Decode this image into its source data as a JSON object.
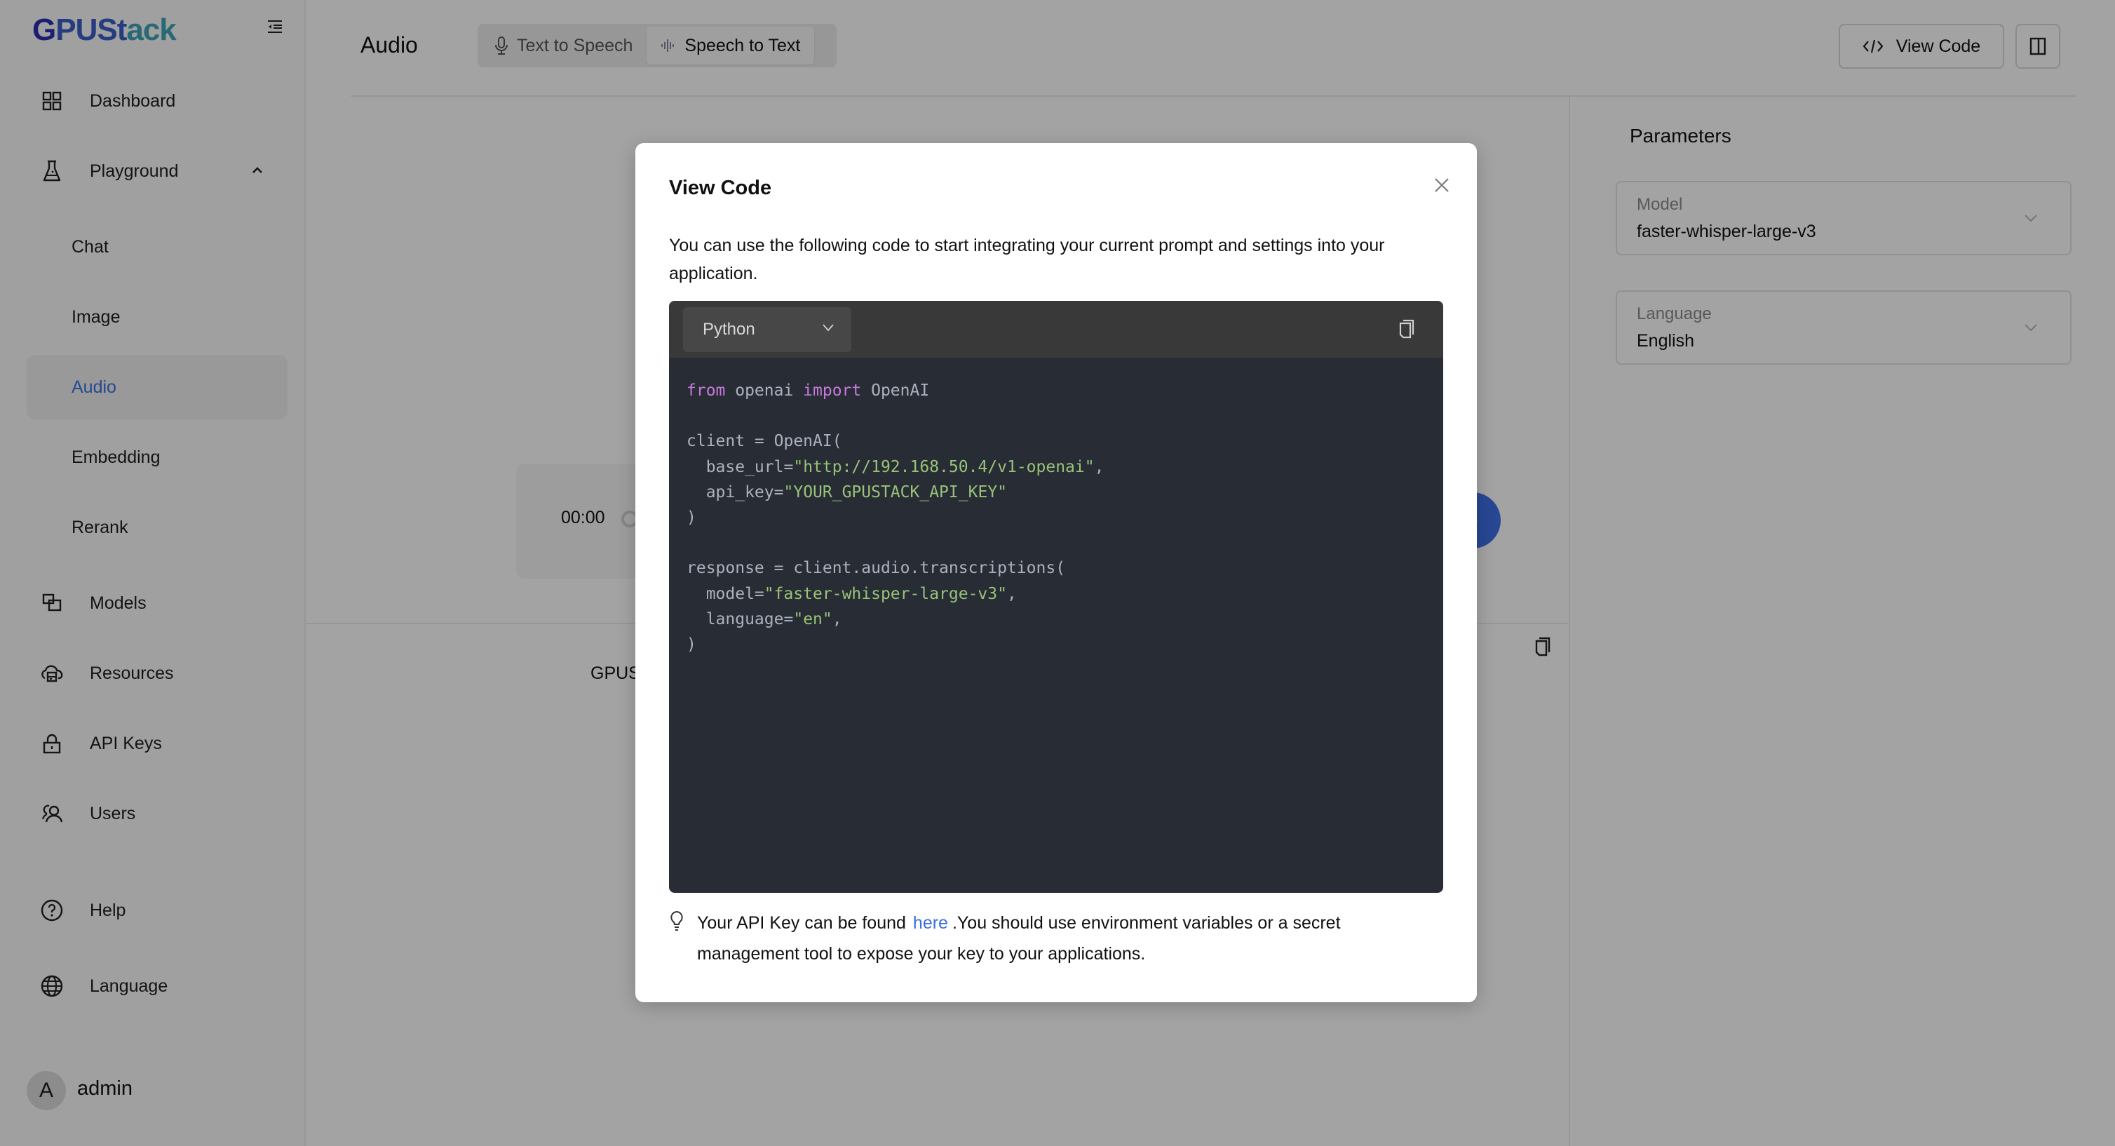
{
  "app": {
    "logo_text": [
      "G",
      "PUSt",
      "ack"
    ]
  },
  "sidebar": {
    "items": [
      {
        "id": "dashboard",
        "label": "Dashboard",
        "icon": "dashboard-grid-icon"
      },
      {
        "id": "playground",
        "label": "Playground",
        "icon": "flask-icon",
        "expanded": true
      },
      {
        "id": "chat",
        "label": "Chat",
        "sub": true
      },
      {
        "id": "image",
        "label": "Image",
        "sub": true
      },
      {
        "id": "audio",
        "label": "Audio",
        "sub": true,
        "active": true
      },
      {
        "id": "embedding",
        "label": "Embedding",
        "sub": true
      },
      {
        "id": "rerank",
        "label": "Rerank",
        "sub": true
      },
      {
        "id": "models",
        "label": "Models",
        "icon": "models-icon"
      },
      {
        "id": "resources",
        "label": "Resources",
        "icon": "resources-icon"
      },
      {
        "id": "api-keys",
        "label": "API Keys",
        "icon": "lock-icon"
      },
      {
        "id": "users",
        "label": "Users",
        "icon": "users-icon"
      },
      {
        "id": "help",
        "label": "Help",
        "icon": "help-icon"
      },
      {
        "id": "language",
        "label": "Language",
        "icon": "globe-icon"
      }
    ],
    "user": {
      "initial": "A",
      "name": "admin"
    }
  },
  "header": {
    "title": "Audio",
    "tabs": [
      {
        "label": "Text to Speech",
        "icon": "microphone-icon",
        "active": false
      },
      {
        "label": "Speech to Text",
        "icon": "waveform-icon",
        "active": true
      }
    ],
    "view_code_label": "View Code"
  },
  "main": {
    "timer": "00:00",
    "output_text_partial": "GPUS"
  },
  "parameters": {
    "title": "Parameters",
    "fields": [
      {
        "label": "Model",
        "value": "faster-whisper-large-v3"
      },
      {
        "label": "Language",
        "value": "English"
      }
    ]
  },
  "modal": {
    "title": "View Code",
    "description": "You can use the following code to start integrating your current prompt and settings into your application.",
    "language_selected": "Python",
    "code": {
      "base_url": "http://192.168.50.4/v1-openai",
      "api_key": "YOUR_GPUSTACK_API_KEY",
      "model": "faster-whisper-large-v3",
      "language": "en"
    },
    "tip_before": "Your API Key can be found",
    "tip_link": "here",
    "tip_after": ".You should use environment variables or a secret management tool to expose your key to your applications."
  },
  "colors": {
    "accent": "#3a6fe0",
    "code_bg": "#282c34",
    "code_header_bg": "#393939",
    "keyword": "#c678dd",
    "string": "#98c379"
  }
}
